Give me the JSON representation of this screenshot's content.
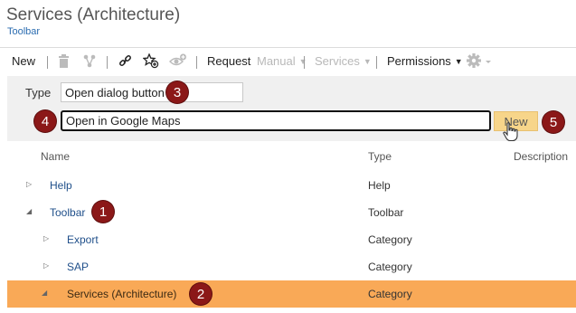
{
  "header": {
    "title": "Services (Architecture)",
    "breadcrumb": "Toolbar"
  },
  "toolbar": {
    "new_label": "New",
    "request_label": "Request",
    "manual_label": "Manual",
    "services_label": "Services",
    "permissions_label": "Permissions",
    "icons": [
      "delete-icon",
      "hierarchy-icon",
      "link-icon",
      "favorite-add-icon",
      "watch-icon",
      "gear-icon"
    ]
  },
  "form": {
    "type_label": "Type",
    "type_value": "Open dialog button",
    "name_value": "Open in Google Maps",
    "new_button_label": "New"
  },
  "columns": {
    "name": "Name",
    "type": "Type",
    "description": "Description"
  },
  "rows": [
    {
      "name": "Help",
      "type": "Help",
      "expanded": false,
      "level": 0
    },
    {
      "name": "Toolbar",
      "type": "Toolbar",
      "expanded": true,
      "level": 0
    },
    {
      "name": "Export",
      "type": "Category",
      "expanded": false,
      "level": 1
    },
    {
      "name": "SAP",
      "type": "Category",
      "expanded": false,
      "level": 1
    },
    {
      "name": "Services (Architecture)",
      "type": "Category",
      "expanded": true,
      "level": 1,
      "selected": true
    }
  ],
  "callouts": [
    "1",
    "2",
    "3",
    "4",
    "5"
  ],
  "colors": {
    "selected_row": "#f9a957",
    "callout": "#8b1818",
    "new_button": "#f7d58a",
    "link": "#1f4f8a"
  }
}
